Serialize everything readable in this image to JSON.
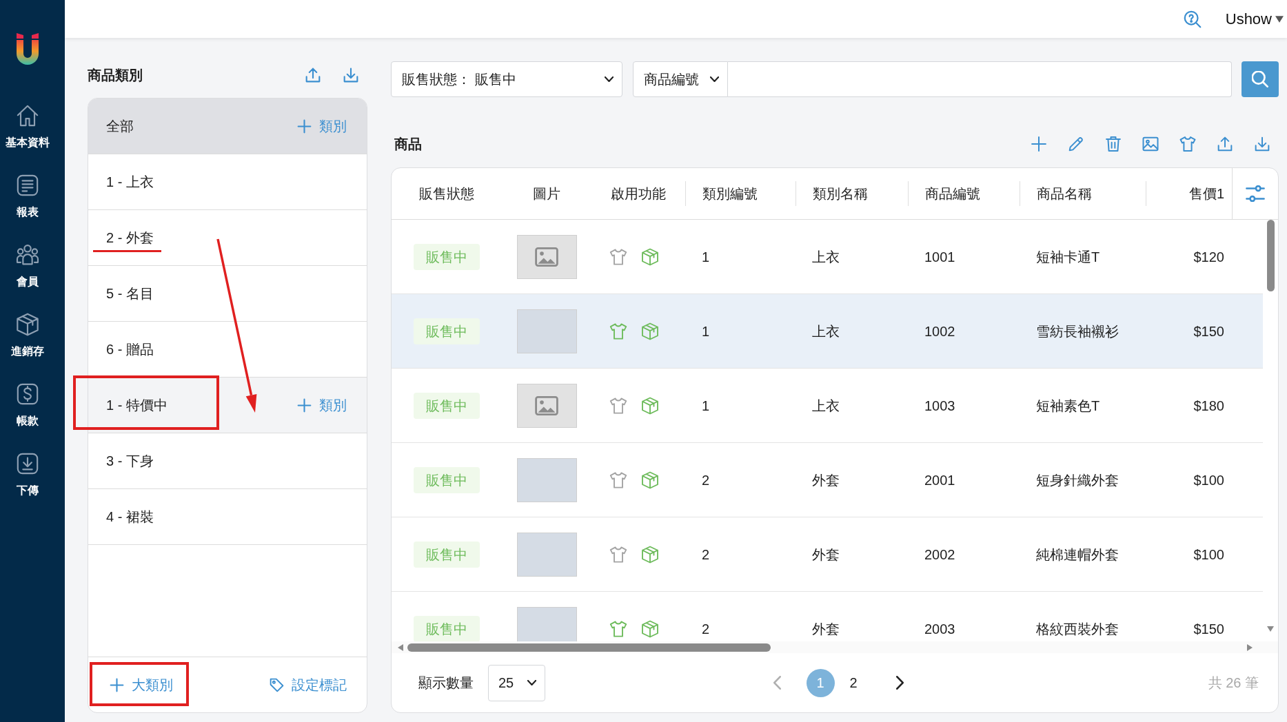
{
  "sidebar": {
    "items": [
      {
        "label": "基本資料"
      },
      {
        "label": "報表"
      },
      {
        "label": "會員"
      },
      {
        "label": "進銷存"
      },
      {
        "label": "帳款"
      },
      {
        "label": "下傳"
      }
    ]
  },
  "header": {
    "user": "Ushow"
  },
  "category_panel": {
    "title": "商品類別",
    "items": [
      {
        "label": "全部",
        "selected": true,
        "hovered": false,
        "underlined": false,
        "framed": false,
        "add_label": "類別"
      },
      {
        "label": "1 - 上衣",
        "selected": false,
        "hovered": false,
        "underlined": false,
        "framed": false
      },
      {
        "label": "2 - 外套",
        "selected": false,
        "hovered": false,
        "underlined": true,
        "framed": false
      },
      {
        "label": "5 - 名目",
        "selected": false,
        "hovered": false,
        "underlined": false,
        "framed": false
      },
      {
        "label": "6 - 贈品",
        "selected": false,
        "hovered": false,
        "underlined": false,
        "framed": false
      },
      {
        "label": "1 - 特價中",
        "selected": false,
        "hovered": true,
        "underlined": false,
        "framed": true,
        "add_label": "類別"
      },
      {
        "label": "3 - 下身",
        "selected": false,
        "hovered": false,
        "underlined": false,
        "framed": false
      },
      {
        "label": "4 - 裙裝",
        "selected": false,
        "hovered": false,
        "underlined": false,
        "framed": false
      }
    ],
    "annotation_arrow": true,
    "footer": {
      "add_group_label": "大類別",
      "add_group_framed": true,
      "tag_label": "設定標記"
    }
  },
  "filters": {
    "status_select": "販售狀態： 販售中",
    "field_select": "商品編號"
  },
  "products": {
    "title": "商品",
    "columns": [
      "販售狀態",
      "圖片",
      "啟用功能",
      "類別編號",
      "類別名稱",
      "商品編號",
      "商品名稱",
      "售價1"
    ],
    "rows": [
      {
        "status": "販售中",
        "has_photo": false,
        "shirt_on": false,
        "box_on": true,
        "category_no": "1",
        "category_name": "上衣",
        "product_no": "1001",
        "product_name": "短袖卡通T",
        "price": "$120",
        "selected": false
      },
      {
        "status": "販售中",
        "has_photo": true,
        "shirt_on": true,
        "box_on": true,
        "category_no": "1",
        "category_name": "上衣",
        "product_no": "1002",
        "product_name": "雪紡長袖襯衫",
        "price": "$150",
        "selected": true
      },
      {
        "status": "販售中",
        "has_photo": false,
        "shirt_on": false,
        "box_on": true,
        "category_no": "1",
        "category_name": "上衣",
        "product_no": "1003",
        "product_name": "短袖素色T",
        "price": "$180",
        "selected": false
      },
      {
        "status": "販售中",
        "has_photo": true,
        "shirt_on": false,
        "box_on": true,
        "category_no": "2",
        "category_name": "外套",
        "product_no": "2001",
        "product_name": "短身針織外套",
        "price": "$100",
        "selected": false
      },
      {
        "status": "販售中",
        "has_photo": true,
        "shirt_on": false,
        "box_on": true,
        "category_no": "2",
        "category_name": "外套",
        "product_no": "2002",
        "product_name": "純棉連帽外套",
        "price": "$100",
        "selected": false
      },
      {
        "status": "販售中",
        "has_photo": true,
        "shirt_on": true,
        "box_on": true,
        "category_no": "2",
        "category_name": "外套",
        "product_no": "2003",
        "product_name": "格紋西裝外套",
        "price": "$150",
        "selected": false
      }
    ]
  },
  "pagination": {
    "page_size_label": "顯示數量",
    "page_size": "25",
    "prev_disabled": true,
    "next_disabled": false,
    "pages": [
      {
        "label": "1",
        "selected": true
      },
      {
        "label": "2",
        "selected": false
      }
    ],
    "total": "共 26 筆"
  }
}
